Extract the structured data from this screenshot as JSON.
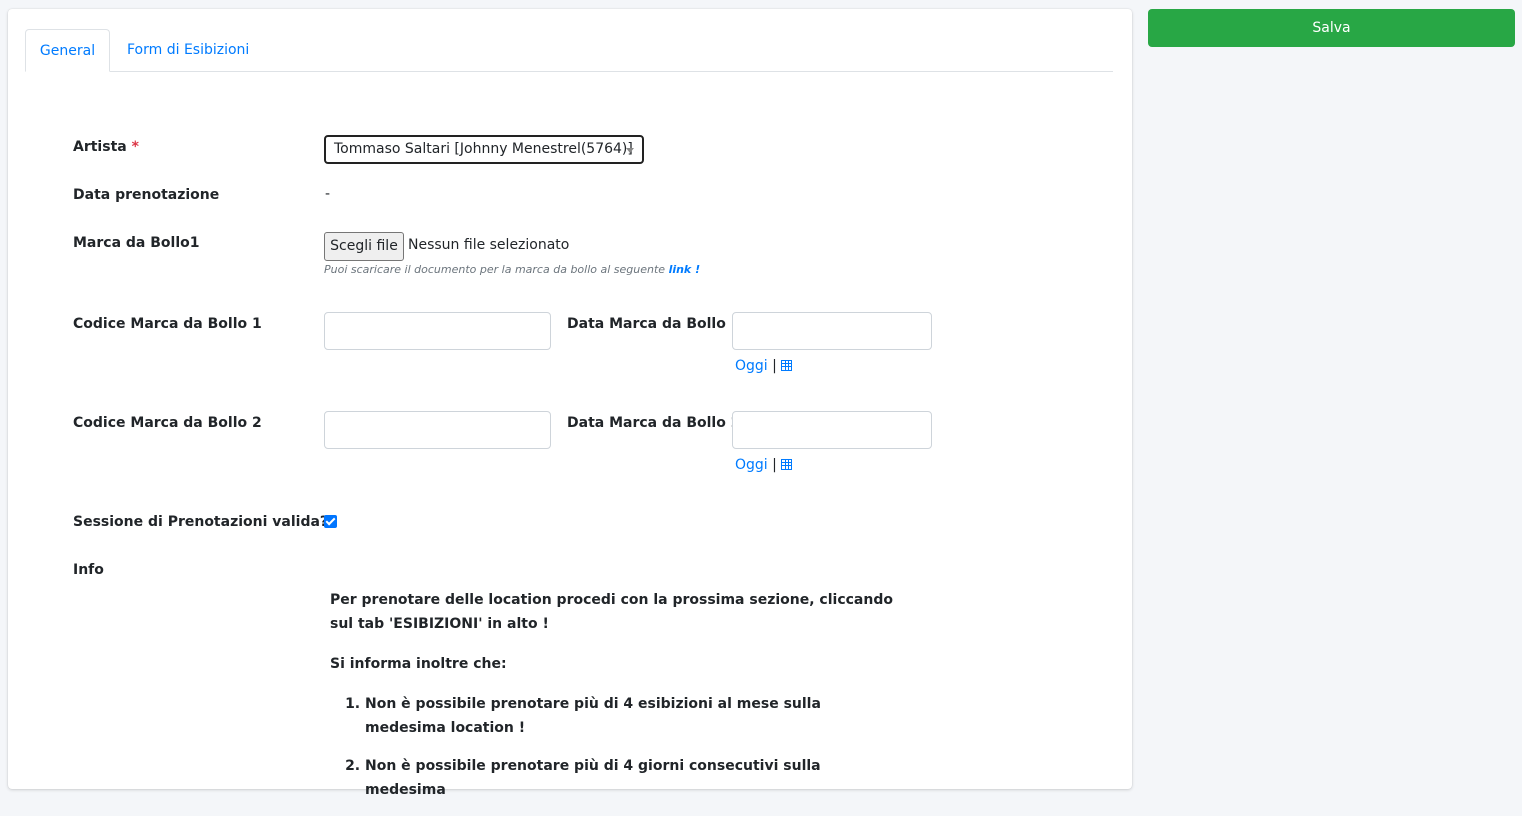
{
  "tabs": [
    {
      "label": "General",
      "active": true
    },
    {
      "label": "Form di Esibizioni",
      "active": false
    }
  ],
  "actions": {
    "save_label": "Salva"
  },
  "form": {
    "artista": {
      "label": "Artista",
      "required_mark": "*",
      "value": "Tommaso Saltari [Johnny Menestrel(5764)]"
    },
    "data_prenotazione": {
      "label": "Data prenotazione",
      "value": "-"
    },
    "marca_bollo1": {
      "label": "Marca da Bollo1",
      "button_label": "Scegli file",
      "file_status": "Nessun file selezionato",
      "hint_text": "Puoi scaricare il documento per la marca da bollo al seguente ",
      "hint_link": "link !"
    },
    "codice1": {
      "label": "Codice Marca da Bollo 1",
      "value": ""
    },
    "data1": {
      "label": "Data Marca da Bollo 1",
      "value": "",
      "today_label": "Oggi",
      "separator": "|"
    },
    "codice2": {
      "label": "Codice Marca da Bollo 2",
      "value": ""
    },
    "data2": {
      "label": "Data Marca da Bollo 2",
      "value": "",
      "today_label": "Oggi",
      "separator": "|"
    },
    "sessione": {
      "label": "Sessione di Prenotazioni valida?",
      "checked": true
    },
    "info": {
      "label": "Info",
      "paragraph1": "Per prenotare delle location procedi con la prossima sezione, cliccando sul tab 'ESIBIZIONI' in alto !",
      "paragraph2": "Si informa inoltre che:",
      "items": [
        "Non è possibile prenotare più di 4 esibizioni al mese sulla medesima location !",
        "Non è possibile prenotare più di 4 giorni consecutivi sulla medesima"
      ]
    }
  },
  "colors": {
    "primary": "#007bff",
    "success": "#28a745",
    "required": "#dc3545"
  },
  "icons": {
    "calendar": "calendar-icon",
    "dropdown": "chevron-down-icon"
  }
}
